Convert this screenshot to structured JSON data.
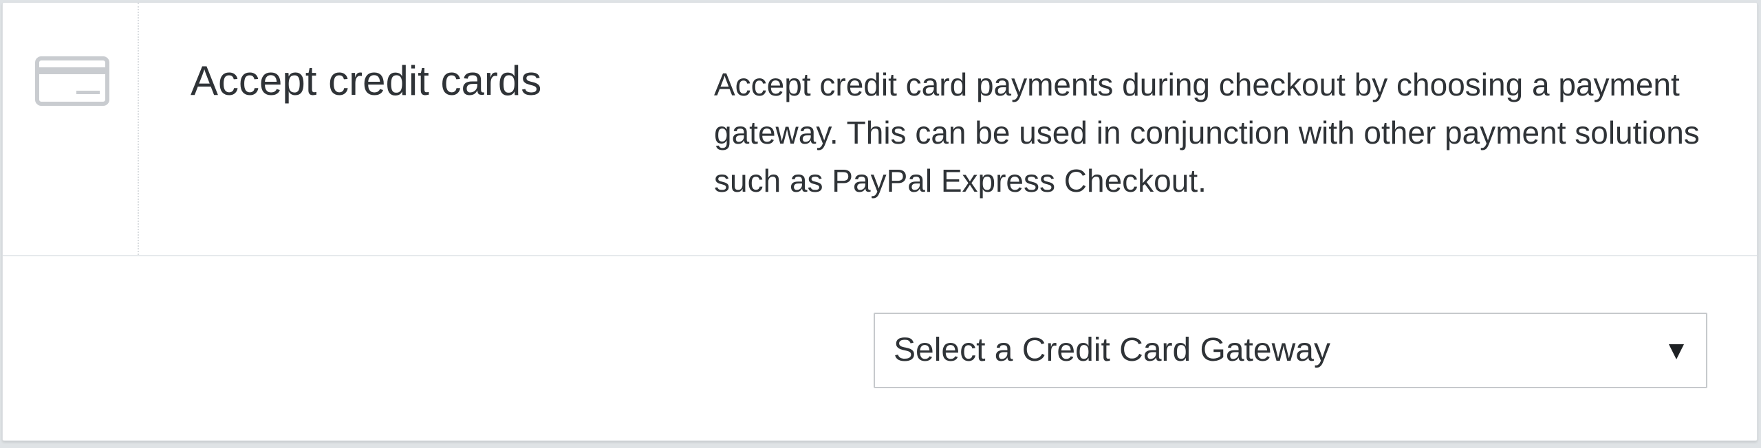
{
  "feature": {
    "icon": "credit-card-icon",
    "title": "Accept credit cards",
    "description": "Accept credit card payments during checkout by choosing a payment gateway. This can be used in conjunction with other payment solutions such as PayPal Express Checkout."
  },
  "gateway_select": {
    "selected": "Select a Credit Card Gateway",
    "caret_icon": "caret-down-icon"
  },
  "colors": {
    "text": "#2f3337",
    "icon": "#c9ccd0",
    "border": "#c6c9cc"
  }
}
